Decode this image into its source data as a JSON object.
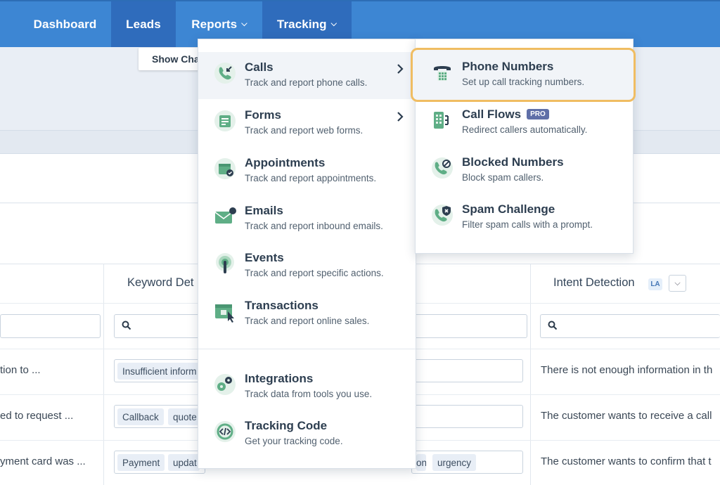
{
  "nav": {
    "items": [
      {
        "label": "Dashboard",
        "has_chevron": false,
        "active": false
      },
      {
        "label": "Leads",
        "has_chevron": false,
        "active": true
      },
      {
        "label": "Reports",
        "has_chevron": true,
        "active": false
      },
      {
        "label": "Tracking",
        "has_chevron": true,
        "active": true
      }
    ],
    "color": "#3d86d3",
    "active_color": "#2f6cbc"
  },
  "background": {
    "show_chart_label": "Show Chart",
    "columns": {
      "keyword": "Keyword Det",
      "intent": "Intent Detection",
      "intent_badge": "LA"
    },
    "rows": [
      {
        "summary": "tion to ...",
        "tags": [
          "Insufficient inform"
        ],
        "intent": "There is not enough information in th"
      },
      {
        "summary": "ed to request ...",
        "tags": [
          "Callback",
          "quote"
        ],
        "intent": "The customer wants to receive a call"
      },
      {
        "summary": "yment card was ...",
        "tags": [
          "Payment",
          "updat",
          "urgency"
        ],
        "tag_fragment": "on",
        "intent": "The customer wants to confirm that t"
      }
    ]
  },
  "tracking_menu": {
    "primary": [
      {
        "icon": "incoming-call-icon",
        "title": "Calls",
        "subtitle": "Track and report phone calls.",
        "has_submenu": true
      },
      {
        "icon": "form-icon",
        "title": "Forms",
        "subtitle": "Track and report web forms.",
        "has_submenu": true
      },
      {
        "icon": "calendar-icon",
        "title": "Appointments",
        "subtitle": "Track and report appointments.",
        "has_submenu": false
      },
      {
        "icon": "envelope-icon",
        "title": "Emails",
        "subtitle": "Track and report inbound emails.",
        "has_submenu": false
      },
      {
        "icon": "touch-target-icon",
        "title": "Events",
        "subtitle": "Track and report specific actions.",
        "has_submenu": false
      },
      {
        "icon": "shop-cursor-icon",
        "title": "Transactions",
        "subtitle": "Track and report online sales.",
        "has_submenu": false
      }
    ],
    "secondary": [
      {
        "icon": "integrations-gears-icon",
        "title": "Integrations",
        "subtitle": "Track data from tools you use."
      },
      {
        "icon": "code-icon",
        "title": "Tracking Code",
        "subtitle": "Get your tracking code."
      }
    ],
    "calls_submenu": [
      {
        "icon": "desk-phone-icon",
        "title": "Phone Numbers",
        "subtitle": "Set up call tracking numbers.",
        "highlighted": true
      },
      {
        "icon": "call-flow-icon",
        "title": "Call Flows",
        "badge": "PRO",
        "subtitle": "Redirect callers automatically."
      },
      {
        "icon": "blocked-phone-icon",
        "title": "Blocked Numbers",
        "subtitle": "Block spam callers."
      },
      {
        "icon": "shield-phone-icon",
        "title": "Spam Challenge",
        "subtitle": "Filter spam calls with a prompt."
      }
    ],
    "icon_color": "#5fae86",
    "highlight_color": "#f0bd62"
  }
}
